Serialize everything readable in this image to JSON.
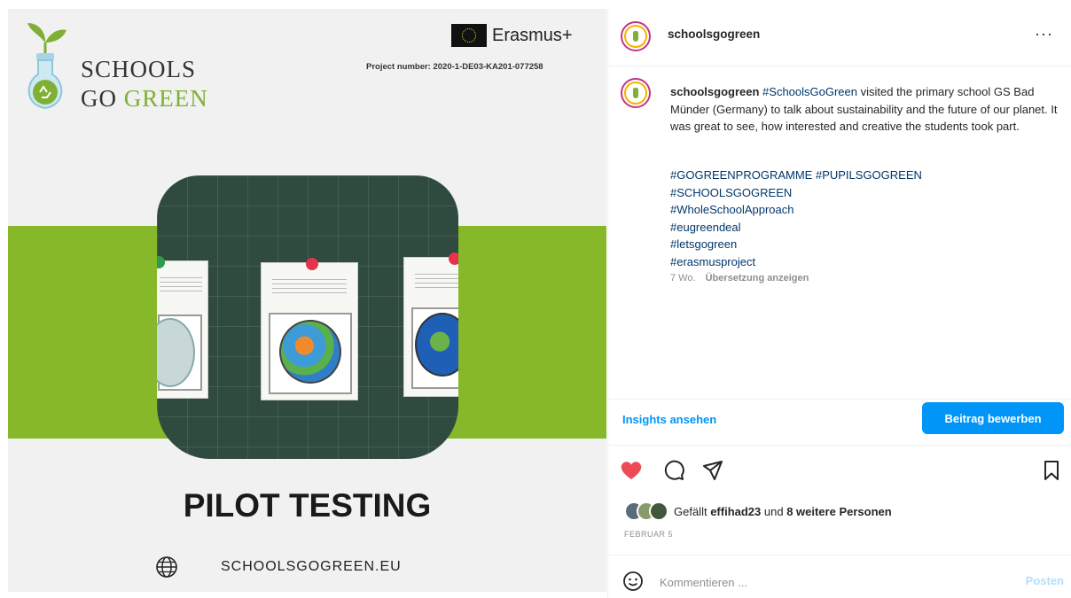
{
  "post_image": {
    "logo_line_1": "SCHOOLS",
    "logo_line_2_a": "GO",
    "logo_line_2_b": "GREEN",
    "erasmus_label": "Erasmus+",
    "project_number": "Project number: 2020-1-DE03-KA201-077258",
    "title": "PILOT TESTING",
    "website": "SCHOOLSGOGREEN.EU",
    "colors": {
      "green_band": "#86b829",
      "chalkboard": "#2f4a3e"
    }
  },
  "header": {
    "username": "schoolsgogreen",
    "more_icon": "···"
  },
  "caption": {
    "username": "schoolsgogreen",
    "tag": "#SchoolsGoGreen",
    "text": " visited the primary school GS Bad Münder (Germany) to talk about sustainability and the future of our planet. It was great to see, how interested and creative the students took part.",
    "hashtags": [
      "#GOGREENPROGRAMME #PUPILSGOGREEN",
      "#SCHOOLSGOGREEN",
      "#WholeSchoolApproach",
      "#eugreendeal",
      "#letsgogreen",
      "#erasmusproject"
    ],
    "age": "7 Wo.",
    "translate_label": "Übersetzung anzeigen"
  },
  "insights": {
    "link_label": "Insights ansehen",
    "promote_label": "Beitrag bewerben"
  },
  "actions": {
    "icons": [
      "heart-icon",
      "comment-icon",
      "share-icon",
      "bookmark-icon"
    ],
    "like_color": "#ed4956"
  },
  "likes": {
    "prefix": "Gefällt ",
    "user": "effihad23",
    "middle": " und ",
    "others": "8 weitere Personen"
  },
  "date": "FEBRUAR 5",
  "comment": {
    "placeholder": "Kommentieren ...",
    "post_label": "Posten"
  }
}
